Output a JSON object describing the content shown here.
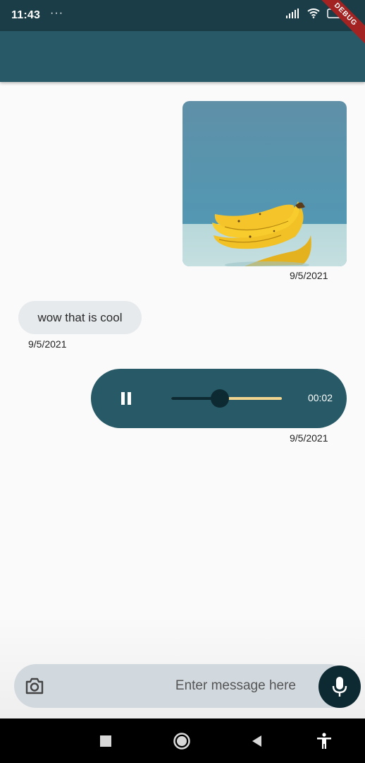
{
  "status_bar": {
    "time": "11:43",
    "notification_dots": "···",
    "debug_banner": "DEBUG",
    "icons": [
      "signal-icon",
      "wifi-icon",
      "battery-icon"
    ]
  },
  "messages": [
    {
      "type": "image",
      "side": "right",
      "image": "bananas-photo",
      "date": "9/5/2021"
    },
    {
      "type": "text",
      "side": "left",
      "text": "wow that is cool",
      "date": "9/5/2021"
    },
    {
      "type": "audio",
      "side": "right",
      "state": "playing",
      "progress": 0.44,
      "duration": "00:02",
      "date": "9/5/2021"
    }
  ],
  "composer": {
    "placeholder": "Enter message here",
    "camera_icon": "camera-icon",
    "mic_icon": "mic-icon"
  },
  "nav_bar": {
    "buttons": [
      "recents-icon",
      "home-icon",
      "back-icon",
      "accessibility-icon"
    ]
  },
  "colors": {
    "status_bar": "#1b3d47",
    "app_bar": "#275a66",
    "audio_bubble": "#275a66",
    "accent_dark": "#0d2a32",
    "track": "#f2d58e",
    "text_bubble": "#e6eaec",
    "input_bar": "#d2d9de"
  }
}
